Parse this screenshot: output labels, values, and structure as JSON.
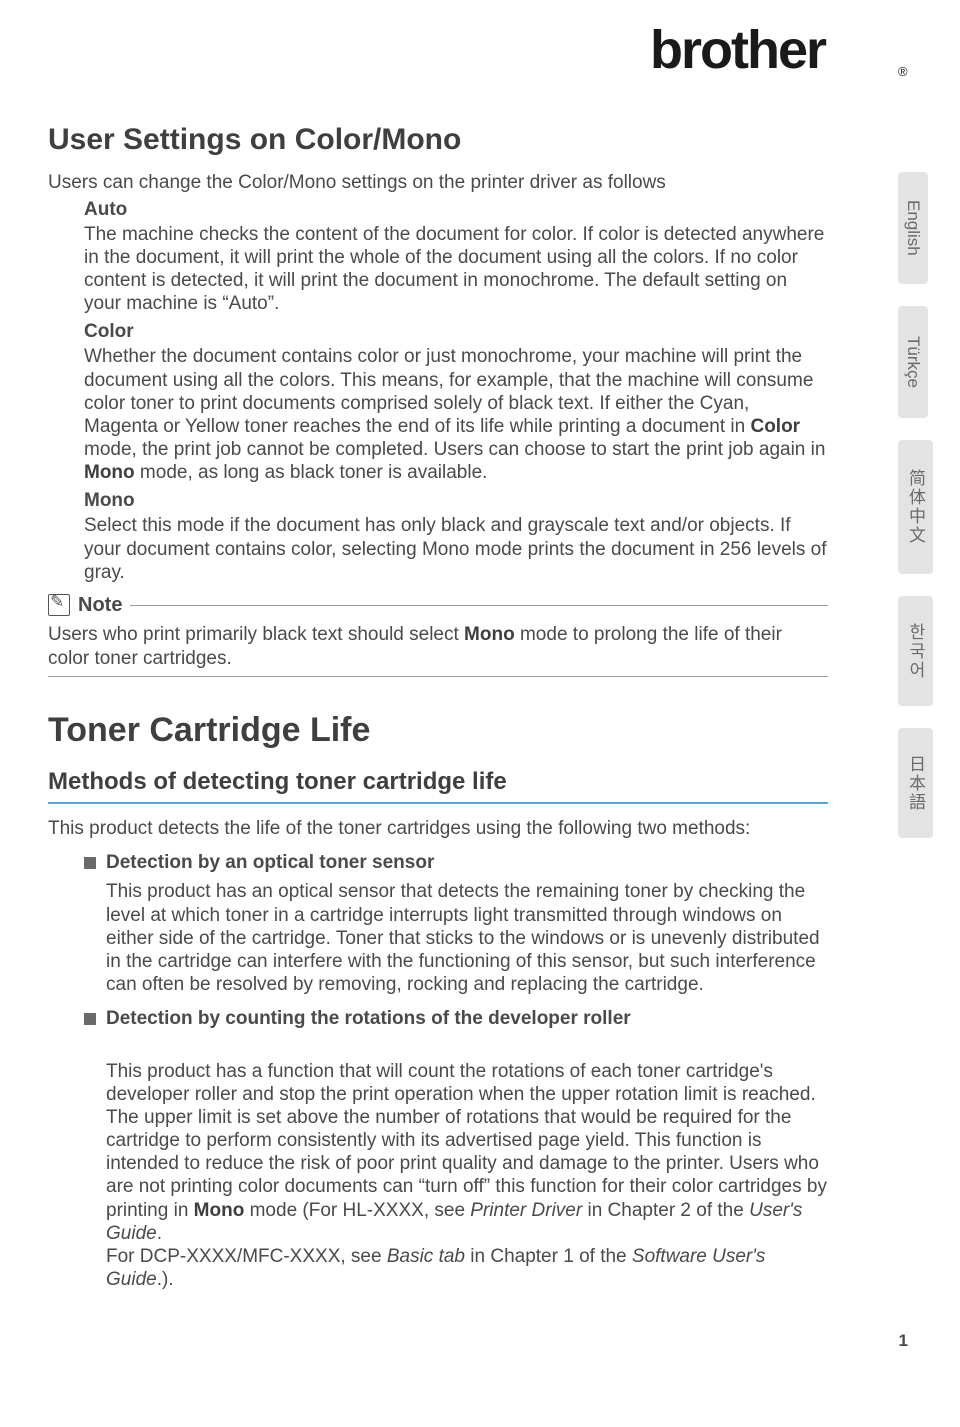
{
  "brand": "brother",
  "section1": {
    "title": "User Settings on Color/Mono",
    "intro": "Users can change the Color/Mono settings on the printer driver as follows",
    "modes": {
      "auto": {
        "label": "Auto",
        "body": "The machine checks the content of the document for color. If color is detected anywhere in the document, it will print the whole of the document using all the colors. If no color content is detected, it will print the document in monochrome. The default setting on your machine is “Auto”."
      },
      "color": {
        "label": "Color",
        "body_pre": "Whether the document contains color or just monochrome, your machine will print the document using all the colors. This means, for example, that the machine will consume color toner to print documents comprised solely of black text. If either the Cyan, Magenta or Yellow toner reaches the end of its life while printing a document in ",
        "bold1": "Color",
        "body_mid": " mode, the print job cannot be completed. Users can choose to start the print job again in ",
        "bold2": "Mono",
        "body_post": " mode, as long as black toner is available."
      },
      "mono": {
        "label": "Mono",
        "body": "Select this mode if the document has only black and grayscale text and/or objects. If your document contains color, selecting Mono mode prints the document in 256 levels of gray."
      }
    },
    "note": {
      "label": "Note",
      "body_pre": "Users who print primarily black text should select ",
      "bold": "Mono",
      "body_post": " mode to prolong the life of their color toner cartridges."
    }
  },
  "section2": {
    "title": "Toner Cartridge Life",
    "subtitle": "Methods of detecting toner cartridge life",
    "intro": "This product detects the life of the toner cartridges using the following two methods:",
    "items": [
      {
        "label": "Detection by an optical toner sensor",
        "body": "This product has an optical sensor that detects the remaining toner by checking the level at which toner in a cartridge interrupts light transmitted through windows on either side of the cartridge. Toner that sticks to the windows or is unevenly distributed in the cartridge can interfere with the functioning of this sensor, but such interference can often be resolved by removing, rocking and replacing the cartridge."
      },
      {
        "label": "Detection by counting the rotations of the developer roller",
        "body_pre": "This product has a function that will count the rotations of each toner cartridge's developer roller and stop the print operation when the upper rotation limit is reached. The upper limit is set above the number of rotations that would be required for the cartridge to perform consistently with its advertised page yield. This function is intended to reduce the risk of poor print quality and damage to the printer. Users who are not printing color documents can “turn off” this function for their color cartridges by printing in ",
        "bold1": "Mono",
        "body_mid1": " mode (For HL-XXXX, see ",
        "ital1": "Printer Driver",
        "body_mid2": " in Chapter 2 of the ",
        "ital2": "User's Guide",
        "body_mid3": ".\nFor DCP-XXXX/MFC-XXXX, see ",
        "ital3": "Basic tab",
        "body_mid4": " in Chapter 1 of the ",
        "ital4": "Software User's Guide",
        "body_post": ".)."
      }
    ]
  },
  "langs": [
    "English",
    "Türkçe",
    "简体中文",
    "한국어",
    "日本語"
  ],
  "page_number": "1"
}
